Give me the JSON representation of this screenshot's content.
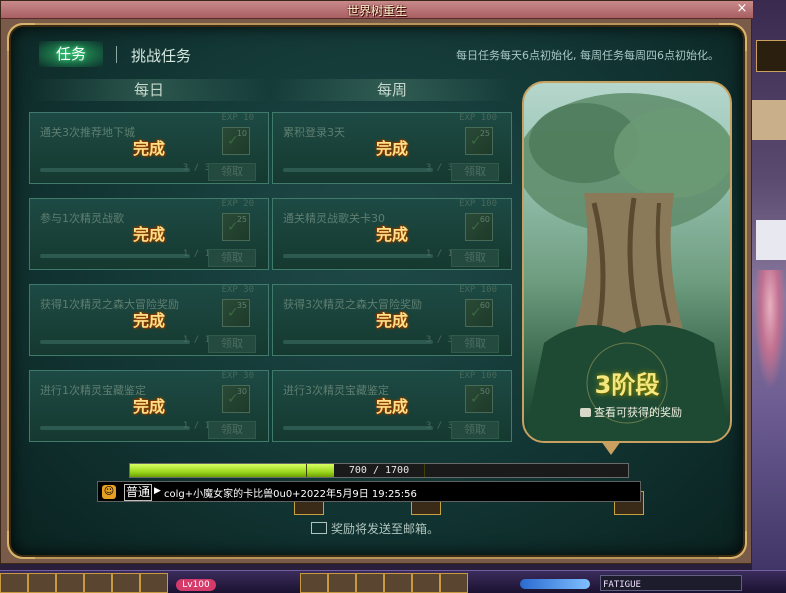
{
  "window": {
    "title": "世界树重生",
    "close_glyph": "×"
  },
  "tabs": [
    {
      "label": "任务",
      "active": true
    },
    {
      "label": "挑战任务",
      "active": false
    }
  ],
  "reset_info": "每日任务每天6点初始化, 每周任务每周四6点初始化。",
  "columns": {
    "daily": "每日",
    "weekly": "每周"
  },
  "daily_tasks": [
    {
      "name": "通关3次推荐地下城",
      "exp": "EXP 10",
      "count": "10",
      "progress": "3 / 3",
      "status": "完成",
      "claim": "领取"
    },
    {
      "name": "参与1次精灵战歌",
      "exp": "EXP 20",
      "count": "25",
      "progress": "1 / 1",
      "status": "完成",
      "claim": "领取"
    },
    {
      "name": "获得1次精灵之森大冒险奖励",
      "exp": "EXP 30",
      "count": "35",
      "progress": "1 / 1",
      "status": "完成",
      "claim": "领取"
    },
    {
      "name": "进行1次精灵宝藏鉴定",
      "exp": "EXP 30",
      "count": "30",
      "progress": "1 / 1",
      "status": "完成",
      "claim": "领取"
    }
  ],
  "weekly_tasks": [
    {
      "name": "累积登录3天",
      "exp": "EXP 100",
      "count": "25",
      "progress": "3 / 3",
      "status": "完成",
      "claim": "领取"
    },
    {
      "name": "通关精灵战歌关卡30",
      "exp": "EXP 100",
      "count": "60",
      "progress": "1 / 1",
      "status": "完成",
      "claim": "领取"
    },
    {
      "name": "获得3次精灵之森大冒险奖励",
      "exp": "EXP 100",
      "count": "60",
      "progress": "3 / 3",
      "status": "完成",
      "claim": "领取"
    },
    {
      "name": "进行3次精灵宝藏鉴定",
      "exp": "EXP 100",
      "count": "50",
      "progress": "3 / 3",
      "status": "完成",
      "claim": "领取"
    }
  ],
  "stage": {
    "label": "3阶段",
    "reward_link": "查看可获得的奖励"
  },
  "progress": {
    "current": 700,
    "max": 1700,
    "text": "700 / 1700",
    "fraction": 0.41
  },
  "chat": {
    "channel": "普通",
    "message": "colg+小魔女家的卡比兽0u0+2022年5月9日 19:25:56"
  },
  "mail_note": "奖励将发送至邮箱。",
  "hud": {
    "level": "Lv100",
    "fatigue": "FATIGUE"
  }
}
